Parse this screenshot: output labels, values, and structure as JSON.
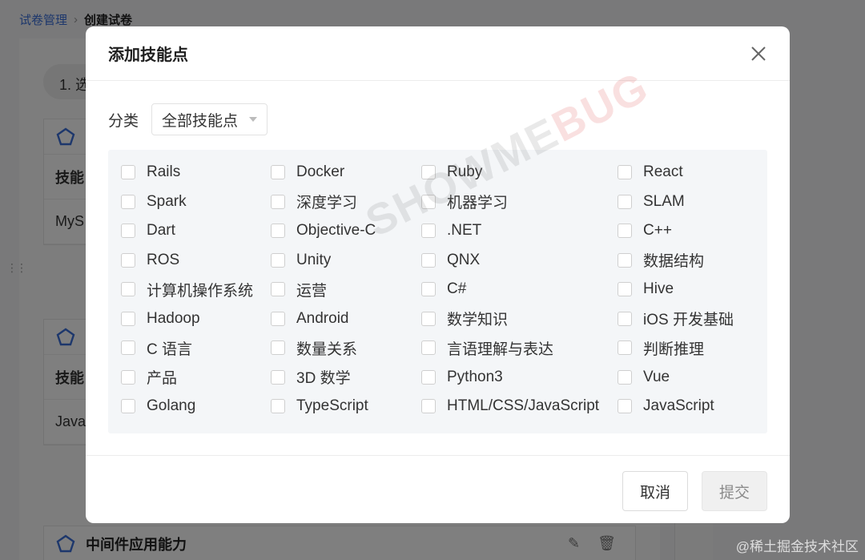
{
  "breadcrumb": {
    "parent": "试卷管理",
    "separator": "›",
    "current": "创建试卷"
  },
  "background": {
    "step_label": "1. 选",
    "cards": [
      {
        "header_label": "技能",
        "row_value": "MyS"
      },
      {
        "header_label": "技能",
        "row_value": "Java"
      },
      {
        "title": "中间件应用能力"
      }
    ]
  },
  "modal": {
    "title": "添加技能点",
    "filter_label": "分类",
    "filter_value": "全部技能点",
    "skills": [
      "Rails",
      "Docker",
      "Ruby",
      "React",
      "Spark",
      "深度学习",
      "机器学习",
      "SLAM",
      "Dart",
      "Objective-C",
      ".NET",
      "C++",
      "ROS",
      "Unity",
      "QNX",
      "数据结构",
      "计算机操作系统",
      "运营",
      "C#",
      "Hive",
      "Hadoop",
      "Android",
      "数学知识",
      "iOS 开发基础",
      "C 语言",
      "数量关系",
      "言语理解与表达",
      "判断推理",
      "产品",
      "3D 数学",
      "Python3",
      "Vue",
      "Golang",
      "TypeScript",
      "HTML/CSS/JavaScript",
      "JavaScript"
    ],
    "cancel_label": "取消",
    "submit_label": "提交"
  },
  "watermark": {
    "part_a": "SHOWME",
    "part_b": "BUG"
  },
  "site_watermark": "@稀土掘金技术社区",
  "colors": {
    "link": "#3b6fd8",
    "accent_icon": "#3b6fd8",
    "panel_bg": "#f4f6f8"
  }
}
